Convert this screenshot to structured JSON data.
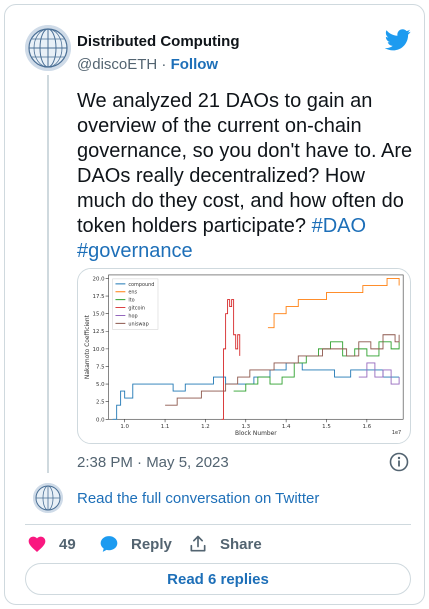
{
  "author": {
    "name": "Distributed Computing",
    "handle": "@discoETH",
    "separator": " · ",
    "follow_label": "Follow",
    "avatar_icon": "globe-network-icon"
  },
  "brand": {
    "logo_icon": "twitter-bird-icon",
    "color": "#1d9bf0"
  },
  "tweet": {
    "text": "We analyzed 21 DAOs to gain an overview of the current on-chain governance, so you don't have to. Are DAOs really decentralized? How much do they cost, and how often do token holders participate?",
    "hashtags": [
      "#DAO",
      "#governance"
    ],
    "timestamp": "2:38 PM · May 5, 2023",
    "info_icon": "info-icon"
  },
  "thread": {
    "read_full_label": "Read the full conversation on Twitter"
  },
  "actions": {
    "like_count": "49",
    "reply_label": "Reply",
    "share_label": "Share",
    "like_color": "#f91880",
    "reply_color": "#1d9bf0"
  },
  "read_replies_label": "Read 6 replies",
  "chart_data": {
    "type": "line",
    "xlabel": "Block Number",
    "ylabel": "Nakamoto Coefficient",
    "x_multiplier_label": "1e7",
    "xlim": [
      0.96,
      1.69
    ],
    "ylim": [
      0,
      20.5
    ],
    "x_ticks": [
      "1.0",
      "1.1",
      "1.2",
      "1.3",
      "1.4",
      "1.5",
      "1.6"
    ],
    "y_ticks": [
      "0.0",
      "2.5",
      "5.0",
      "7.5",
      "10.0",
      "12.5",
      "15.0",
      "17.5",
      "20.0"
    ],
    "legend_position": "top-left",
    "series": [
      {
        "name": "compound",
        "color": "#1f77b4",
        "x": [
          0.97,
          0.98,
          0.99,
          1.0,
          1.02,
          1.05,
          1.08,
          1.12,
          1.15,
          1.19,
          1.22,
          1.25,
          1.28,
          1.32,
          1.36,
          1.4,
          1.44,
          1.48,
          1.52,
          1.56,
          1.6,
          1.64,
          1.68
        ],
        "y": [
          0,
          2,
          4,
          3,
          5,
          5,
          5,
          4,
          5,
          5,
          6,
          5,
          5,
          6,
          7,
          8,
          7,
          7,
          6,
          7,
          7,
          6,
          6
        ]
      },
      {
        "name": "ens",
        "color": "#ff7f0e",
        "x": [
          1.355,
          1.37,
          1.4,
          1.43,
          1.46,
          1.5,
          1.53,
          1.56,
          1.59,
          1.62,
          1.65,
          1.68
        ],
        "y": [
          13,
          15,
          16,
          17,
          17,
          18,
          18,
          18,
          19,
          19,
          20,
          19
        ]
      },
      {
        "name": "lto",
        "color": "#2ca02c",
        "x": [
          1.27,
          1.3,
          1.33,
          1.36,
          1.39,
          1.42,
          1.45,
          1.48,
          1.51,
          1.54,
          1.57,
          1.6,
          1.63,
          1.66,
          1.68
        ],
        "y": [
          4,
          5,
          6,
          5,
          6,
          8,
          9,
          10,
          11,
          9,
          10,
          9,
          11,
          10,
          11
        ]
      },
      {
        "name": "gitcoin",
        "color": "#d62728",
        "x": [
          1.24,
          1.245,
          1.25,
          1.255,
          1.26,
          1.265,
          1.27,
          1.275,
          1.28,
          1.285
        ],
        "y": [
          0,
          10,
          15,
          17,
          16,
          17,
          12,
          10,
          12,
          9
        ]
      },
      {
        "name": "hop",
        "color": "#9467bd",
        "x": [
          1.58,
          1.6,
          1.62,
          1.64,
          1.66,
          1.68
        ],
        "y": [
          6,
          8,
          6,
          7,
          5,
          6
        ]
      },
      {
        "name": "uniswap",
        "color": "#8c564b",
        "x": [
          1.1,
          1.13,
          1.16,
          1.19,
          1.22,
          1.25,
          1.28,
          1.31,
          1.34,
          1.37,
          1.4,
          1.43,
          1.46,
          1.49,
          1.52,
          1.55,
          1.58,
          1.61,
          1.64,
          1.67,
          1.68
        ],
        "y": [
          2,
          3,
          3,
          4,
          4,
          5,
          6,
          7,
          7,
          8,
          8,
          9,
          9,
          10,
          10,
          9,
          11,
          10,
          12,
          11,
          12
        ]
      }
    ]
  }
}
